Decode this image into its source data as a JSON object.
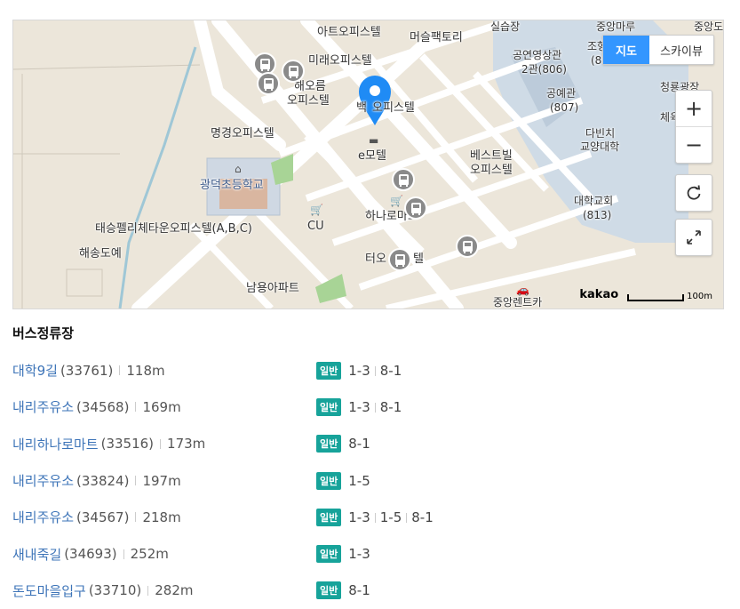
{
  "map": {
    "map_type": {
      "map": "지도",
      "skyview": "스카이뷰"
    },
    "controls": {
      "zoom_in": "+",
      "zoom_out": "−"
    },
    "scale": {
      "brand": "kakao",
      "unit": "100m"
    },
    "labels": {
      "l1": "아트오피스텔",
      "l2": "머슬팩토리",
      "l3": "실습장",
      "l4": "중앙마루",
      "l5": "중앙도",
      "l6": "미래오피스텔",
      "l7": "해오름",
      "l8": "오피스텔",
      "l9": "백",
      "l10": "오피스텔",
      "l11": "공연영상관",
      "l12": "2관(806)",
      "l13": "조형",
      "l14": "(8",
      "l15": "청룡광장",
      "l16": "공예관",
      "l17": "(807)",
      "l18": "체육",
      "l19": "명경오피스텔",
      "l20": "다빈치",
      "l21": "교양대학",
      "l22": "e모텔",
      "l23": "베스트빌",
      "l24": "오피스텔",
      "l25": "광덕초등학교",
      "l26": "대학교회",
      "l27": "(813)",
      "l28": "CU",
      "l29": "하나로마트",
      "l30": "태승펠리체타운오피스텔(A,B,C)",
      "l31": "해송도예",
      "l32": "터오",
      "l33": "텔",
      "l34": "남용아파트",
      "l35": "중앙렌트카"
    },
    "colors": {
      "pin": "#1f8bf5",
      "bus": "#8a8a8a",
      "active": "#3396ff"
    }
  },
  "section_title": "버스정류장",
  "stops": [
    {
      "name": "대학9길",
      "code": "(33761)",
      "distance": "118m",
      "type": "일반",
      "routes": [
        "1-3",
        "8-1"
      ]
    },
    {
      "name": "내리주유소",
      "code": "(34568)",
      "distance": "169m",
      "type": "일반",
      "routes": [
        "1-3",
        "8-1"
      ]
    },
    {
      "name": "내리하나로마트",
      "code": "(33516)",
      "distance": "173m",
      "type": "일반",
      "routes": [
        "8-1"
      ]
    },
    {
      "name": "내리주유소",
      "code": "(33824)",
      "distance": "197m",
      "type": "일반",
      "routes": [
        "1-5"
      ]
    },
    {
      "name": "내리주유소",
      "code": "(34567)",
      "distance": "218m",
      "type": "일반",
      "routes": [
        "1-3",
        "1-5",
        "8-1"
      ]
    },
    {
      "name": "새내죽길",
      "code": "(34693)",
      "distance": "252m",
      "type": "일반",
      "routes": [
        "1-3"
      ]
    },
    {
      "name": "돈도마을입구",
      "code": "(33710)",
      "distance": "282m",
      "type": "일반",
      "routes": [
        "8-1"
      ]
    }
  ],
  "badge_color": "#17a39a",
  "link_color": "#3d74b8"
}
